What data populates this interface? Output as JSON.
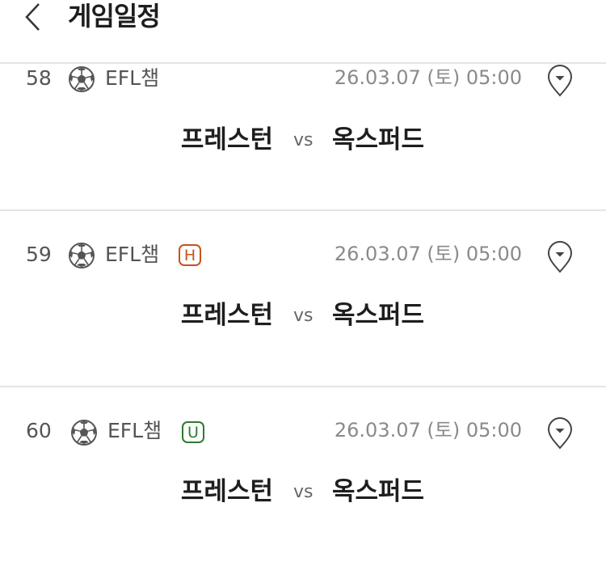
{
  "header": {
    "title": "게임일정"
  },
  "matches": [
    {
      "number": "58",
      "league": "EFL챔",
      "datetime": "26.03.07 (토) 05:00",
      "home": "프레스턴",
      "vs": "vs",
      "away": "옥스퍼드"
    },
    {
      "number": "59",
      "league": "EFL챔",
      "badge": "H",
      "datetime": "26.03.07 (토) 05:00",
      "home": "프레스턴",
      "vs": "vs",
      "away": "옥스퍼드"
    },
    {
      "number": "60",
      "league": "EFL챔",
      "badge": "U",
      "datetime": "26.03.07 (토) 05:00",
      "home": "프레스턴",
      "vs": "vs",
      "away": "옥스퍼드"
    }
  ],
  "colors": {
    "badge_h": "#c8511d",
    "badge_u": "#2e7a2e",
    "divider": "#e4e4e4"
  },
  "icons": {
    "back": "chevron-left-icon",
    "sport": "soccer-ball-icon",
    "pin": "map-pin-icon"
  }
}
